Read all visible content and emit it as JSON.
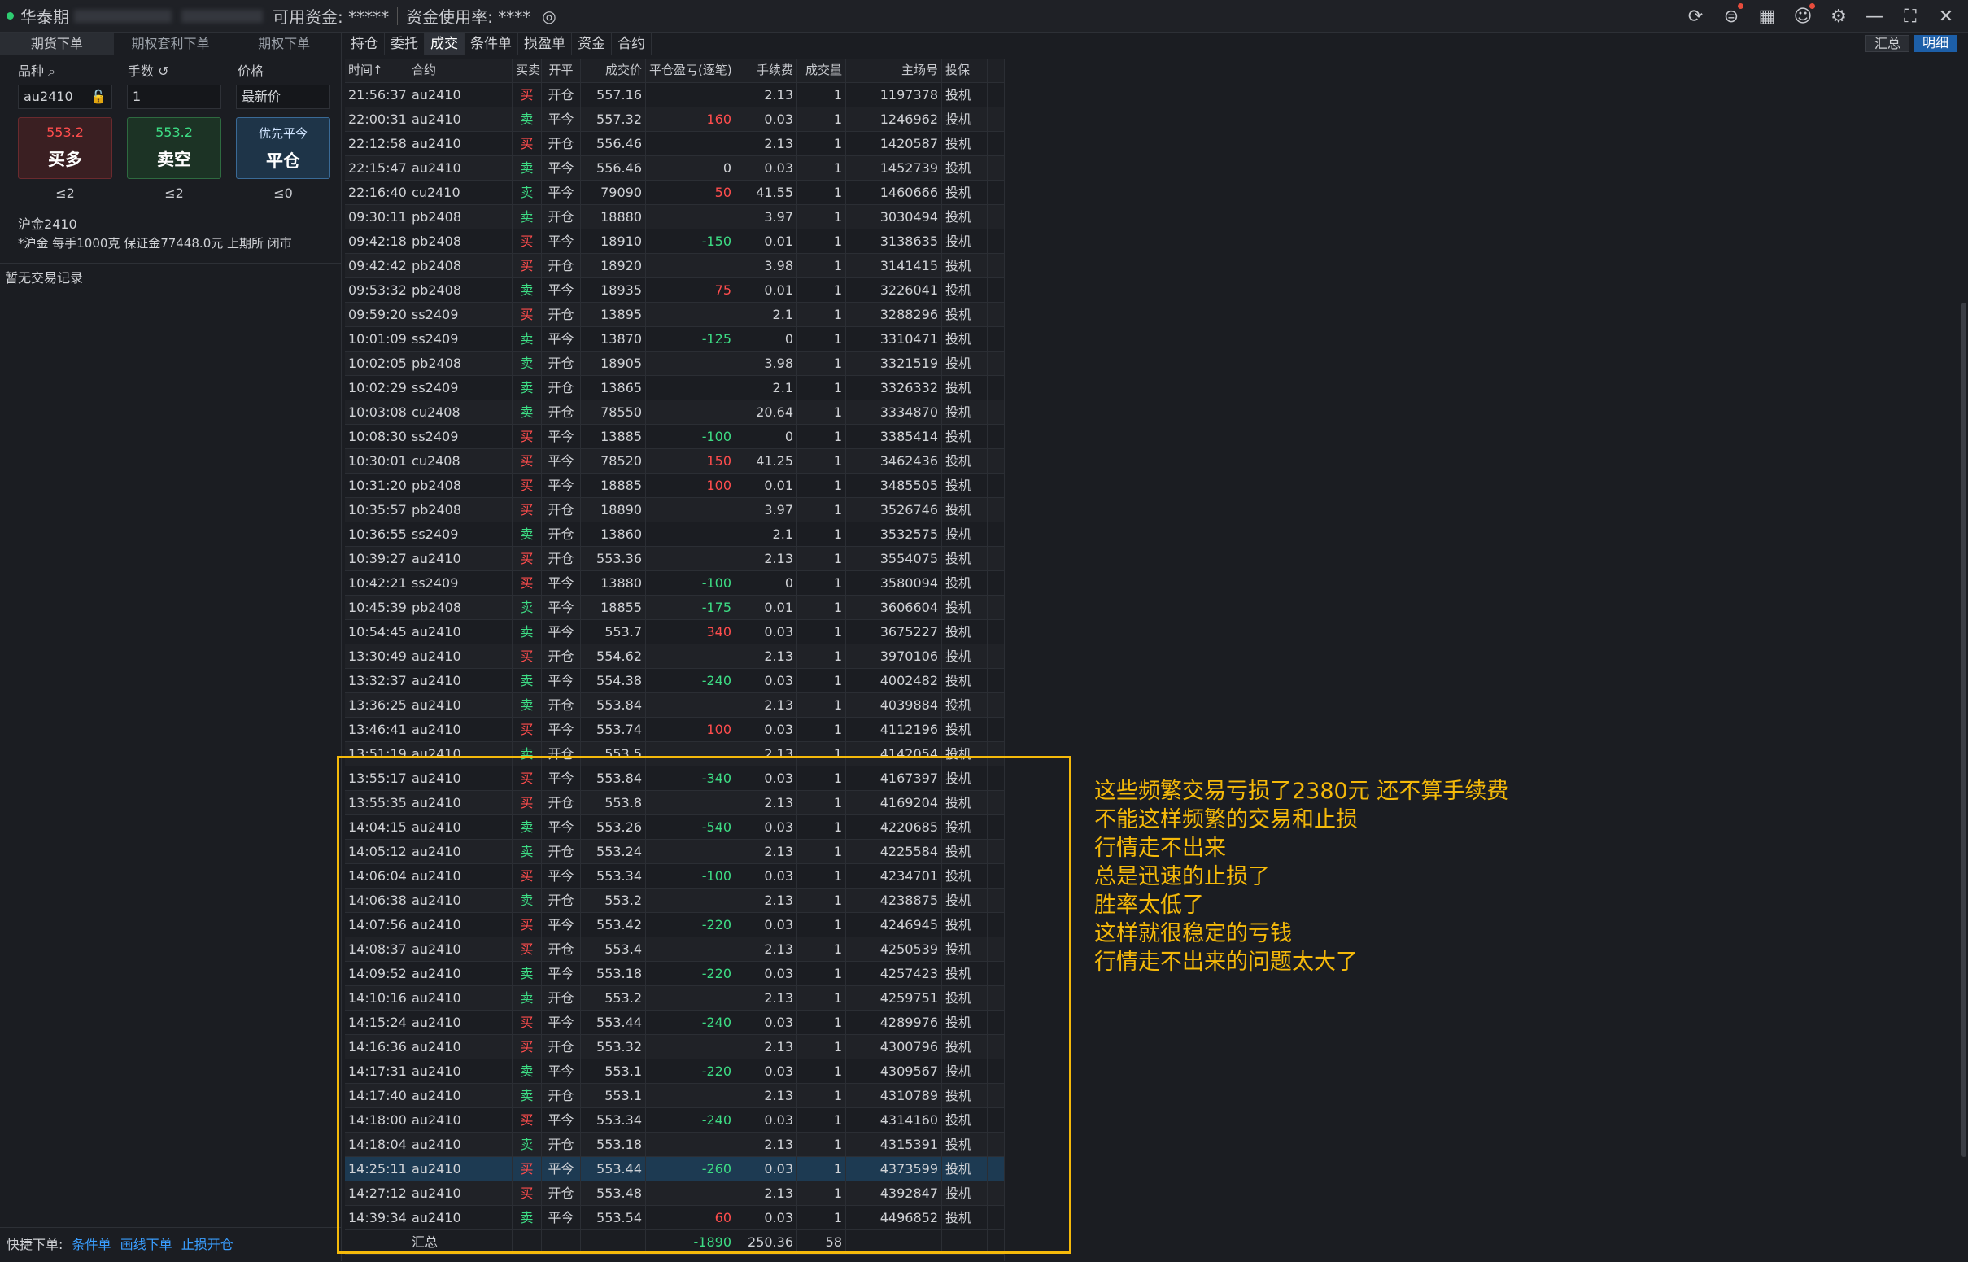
{
  "titlebar": {
    "account_label": "华泰期",
    "funds_label": "可用资金: *****",
    "usage_label": "资金使用率: ****"
  },
  "left": {
    "tabs": [
      "期货下单",
      "期权套利下单",
      "期权下单"
    ],
    "labels": {
      "instrument": "品种",
      "lots": "手数",
      "price": "价格"
    },
    "instrument": "au2410",
    "lots": "1",
    "price_type": "最新价",
    "buy": {
      "price": "553.2",
      "label": "买多",
      "limit": "≤2"
    },
    "sell": {
      "price": "553.2",
      "label": "卖空",
      "limit": "≤2"
    },
    "close": {
      "sub": "优先平今",
      "label": "平仓",
      "limit": "≤0"
    },
    "instrument_name": "沪金2410",
    "instrument_desc": "*沪金 每手1000克 保证金77448.0元 上期所 闭市",
    "no_trade": "暂无交易记录",
    "quick_label": "快捷下单:",
    "quick_links": [
      "条件单",
      "画线下单",
      "止损开仓"
    ]
  },
  "right_tabs": [
    "持仓",
    "委托",
    "成交",
    "条件单",
    "损盈单",
    "资金",
    "合约"
  ],
  "summary_btn": "汇总",
  "detail_btn": "明细",
  "columns": [
    "时间↑",
    "合约",
    "买卖",
    "开平",
    "成交价",
    "平仓盈亏(逐笔)",
    "手续费",
    "成交量",
    "主场号",
    "投保"
  ],
  "rows": [
    [
      "21:56:37",
      "au2410",
      "买",
      "开仓",
      "557.16",
      "",
      "2.13",
      "1",
      "1197378",
      "投机"
    ],
    [
      "22:00:31",
      "au2410",
      "卖",
      "平今",
      "557.32",
      "160",
      "0.03",
      "1",
      "1246962",
      "投机"
    ],
    [
      "22:12:58",
      "au2410",
      "买",
      "开仓",
      "556.46",
      "",
      "2.13",
      "1",
      "1420587",
      "投机"
    ],
    [
      "22:15:47",
      "au2410",
      "卖",
      "平今",
      "556.46",
      "0",
      "0.03",
      "1",
      "1452739",
      "投机"
    ],
    [
      "22:16:40",
      "cu2410",
      "卖",
      "平今",
      "79090",
      "50",
      "41.55",
      "1",
      "1460666",
      "投机"
    ],
    [
      "09:30:11",
      "pb2408",
      "卖",
      "开仓",
      "18880",
      "",
      "3.97",
      "1",
      "3030494",
      "投机"
    ],
    [
      "09:42:18",
      "pb2408",
      "买",
      "平今",
      "18910",
      "-150",
      "0.01",
      "1",
      "3138635",
      "投机"
    ],
    [
      "09:42:42",
      "pb2408",
      "买",
      "开仓",
      "18920",
      "",
      "3.98",
      "1",
      "3141415",
      "投机"
    ],
    [
      "09:53:32",
      "pb2408",
      "卖",
      "平今",
      "18935",
      "75",
      "0.01",
      "1",
      "3226041",
      "投机"
    ],
    [
      "09:59:20",
      "ss2409",
      "买",
      "开仓",
      "13895",
      "",
      "2.1",
      "1",
      "3288296",
      "投机"
    ],
    [
      "10:01:09",
      "ss2409",
      "卖",
      "平今",
      "13870",
      "-125",
      "0",
      "1",
      "3310471",
      "投机"
    ],
    [
      "10:02:05",
      "pb2408",
      "卖",
      "开仓",
      "18905",
      "",
      "3.98",
      "1",
      "3321519",
      "投机"
    ],
    [
      "10:02:29",
      "ss2409",
      "卖",
      "开仓",
      "13865",
      "",
      "2.1",
      "1",
      "3326332",
      "投机"
    ],
    [
      "10:03:08",
      "cu2408",
      "卖",
      "开仓",
      "78550",
      "",
      "20.64",
      "1",
      "3334870",
      "投机"
    ],
    [
      "10:08:30",
      "ss2409",
      "买",
      "平今",
      "13885",
      "-100",
      "0",
      "1",
      "3385414",
      "投机"
    ],
    [
      "10:30:01",
      "cu2408",
      "买",
      "平今",
      "78520",
      "150",
      "41.25",
      "1",
      "3462436",
      "投机"
    ],
    [
      "10:31:20",
      "pb2408",
      "买",
      "平今",
      "18885",
      "100",
      "0.01",
      "1",
      "3485505",
      "投机"
    ],
    [
      "10:35:57",
      "pb2408",
      "买",
      "开仓",
      "18890",
      "",
      "3.97",
      "1",
      "3526746",
      "投机"
    ],
    [
      "10:36:55",
      "ss2409",
      "卖",
      "开仓",
      "13860",
      "",
      "2.1",
      "1",
      "3532575",
      "投机"
    ],
    [
      "10:39:27",
      "au2410",
      "买",
      "开仓",
      "553.36",
      "",
      "2.13",
      "1",
      "3554075",
      "投机"
    ],
    [
      "10:42:21",
      "ss2409",
      "买",
      "平今",
      "13880",
      "-100",
      "0",
      "1",
      "3580094",
      "投机"
    ],
    [
      "10:45:39",
      "pb2408",
      "卖",
      "平今",
      "18855",
      "-175",
      "0.01",
      "1",
      "3606604",
      "投机"
    ],
    [
      "10:54:45",
      "au2410",
      "卖",
      "平今",
      "553.7",
      "340",
      "0.03",
      "1",
      "3675227",
      "投机"
    ],
    [
      "13:30:49",
      "au2410",
      "买",
      "开仓",
      "554.62",
      "",
      "2.13",
      "1",
      "3970106",
      "投机"
    ],
    [
      "13:32:37",
      "au2410",
      "卖",
      "平今",
      "554.38",
      "-240",
      "0.03",
      "1",
      "4002482",
      "投机"
    ],
    [
      "13:36:25",
      "au2410",
      "卖",
      "开仓",
      "553.84",
      "",
      "2.13",
      "1",
      "4039884",
      "投机"
    ],
    [
      "13:46:41",
      "au2410",
      "买",
      "平今",
      "553.74",
      "100",
      "0.03",
      "1",
      "4112196",
      "投机"
    ],
    [
      "13:51:19",
      "au2410",
      "卖",
      "开仓",
      "553.5",
      "",
      "2.13",
      "1",
      "4142054",
      "投机"
    ],
    [
      "13:55:17",
      "au2410",
      "买",
      "平今",
      "553.84",
      "-340",
      "0.03",
      "1",
      "4167397",
      "投机"
    ],
    [
      "13:55:35",
      "au2410",
      "买",
      "开仓",
      "553.8",
      "",
      "2.13",
      "1",
      "4169204",
      "投机"
    ],
    [
      "14:04:15",
      "au2410",
      "卖",
      "平今",
      "553.26",
      "-540",
      "0.03",
      "1",
      "4220685",
      "投机"
    ],
    [
      "14:05:12",
      "au2410",
      "卖",
      "开仓",
      "553.24",
      "",
      "2.13",
      "1",
      "4225584",
      "投机"
    ],
    [
      "14:06:04",
      "au2410",
      "买",
      "平今",
      "553.34",
      "-100",
      "0.03",
      "1",
      "4234701",
      "投机"
    ],
    [
      "14:06:38",
      "au2410",
      "卖",
      "开仓",
      "553.2",
      "",
      "2.13",
      "1",
      "4238875",
      "投机"
    ],
    [
      "14:07:56",
      "au2410",
      "买",
      "平今",
      "553.42",
      "-220",
      "0.03",
      "1",
      "4246945",
      "投机"
    ],
    [
      "14:08:37",
      "au2410",
      "买",
      "开仓",
      "553.4",
      "",
      "2.13",
      "1",
      "4250539",
      "投机"
    ],
    [
      "14:09:52",
      "au2410",
      "卖",
      "平今",
      "553.18",
      "-220",
      "0.03",
      "1",
      "4257423",
      "投机"
    ],
    [
      "14:10:16",
      "au2410",
      "卖",
      "开仓",
      "553.2",
      "",
      "2.13",
      "1",
      "4259751",
      "投机"
    ],
    [
      "14:15:24",
      "au2410",
      "买",
      "平今",
      "553.44",
      "-240",
      "0.03",
      "1",
      "4289976",
      "投机"
    ],
    [
      "14:16:36",
      "au2410",
      "买",
      "开仓",
      "553.32",
      "",
      "2.13",
      "1",
      "4300796",
      "投机"
    ],
    [
      "14:17:31",
      "au2410",
      "卖",
      "平今",
      "553.1",
      "-220",
      "0.03",
      "1",
      "4309567",
      "投机"
    ],
    [
      "14:17:40",
      "au2410",
      "卖",
      "开仓",
      "553.1",
      "",
      "2.13",
      "1",
      "4310789",
      "投机"
    ],
    [
      "14:18:00",
      "au2410",
      "买",
      "平今",
      "553.34",
      "-240",
      "0.03",
      "1",
      "4314160",
      "投机"
    ],
    [
      "14:18:04",
      "au2410",
      "卖",
      "开仓",
      "553.18",
      "",
      "2.13",
      "1",
      "4315391",
      "投机"
    ],
    [
      "14:25:11",
      "au2410",
      "买",
      "平今",
      "553.44",
      "-260",
      "0.03",
      "1",
      "4373599",
      "投机"
    ],
    [
      "14:27:12",
      "au2410",
      "买",
      "开仓",
      "553.48",
      "",
      "2.13",
      "1",
      "4392847",
      "投机"
    ],
    [
      "14:39:34",
      "au2410",
      "卖",
      "平今",
      "553.54",
      "60",
      "0.03",
      "1",
      "4496852",
      "投机"
    ]
  ],
  "selected_row": 44,
  "total": {
    "label": "汇总",
    "pnl": "-1890",
    "fee": "250.36",
    "qty": "58"
  },
  "annotation": [
    "这些频繁交易亏损了2380元 还不算手续费",
    "不能这样频繁的交易和止损",
    "行情走不出来",
    "总是迅速的止损了",
    "胜率太低了",
    "这样就很稳定的亏钱",
    "行情走不出来的问题太大了"
  ],
  "colors": {
    "buy": "#ff4d4d",
    "sell": "#3ddc84",
    "highlight": "#f5b90a",
    "accent": "#1d5fa8"
  }
}
